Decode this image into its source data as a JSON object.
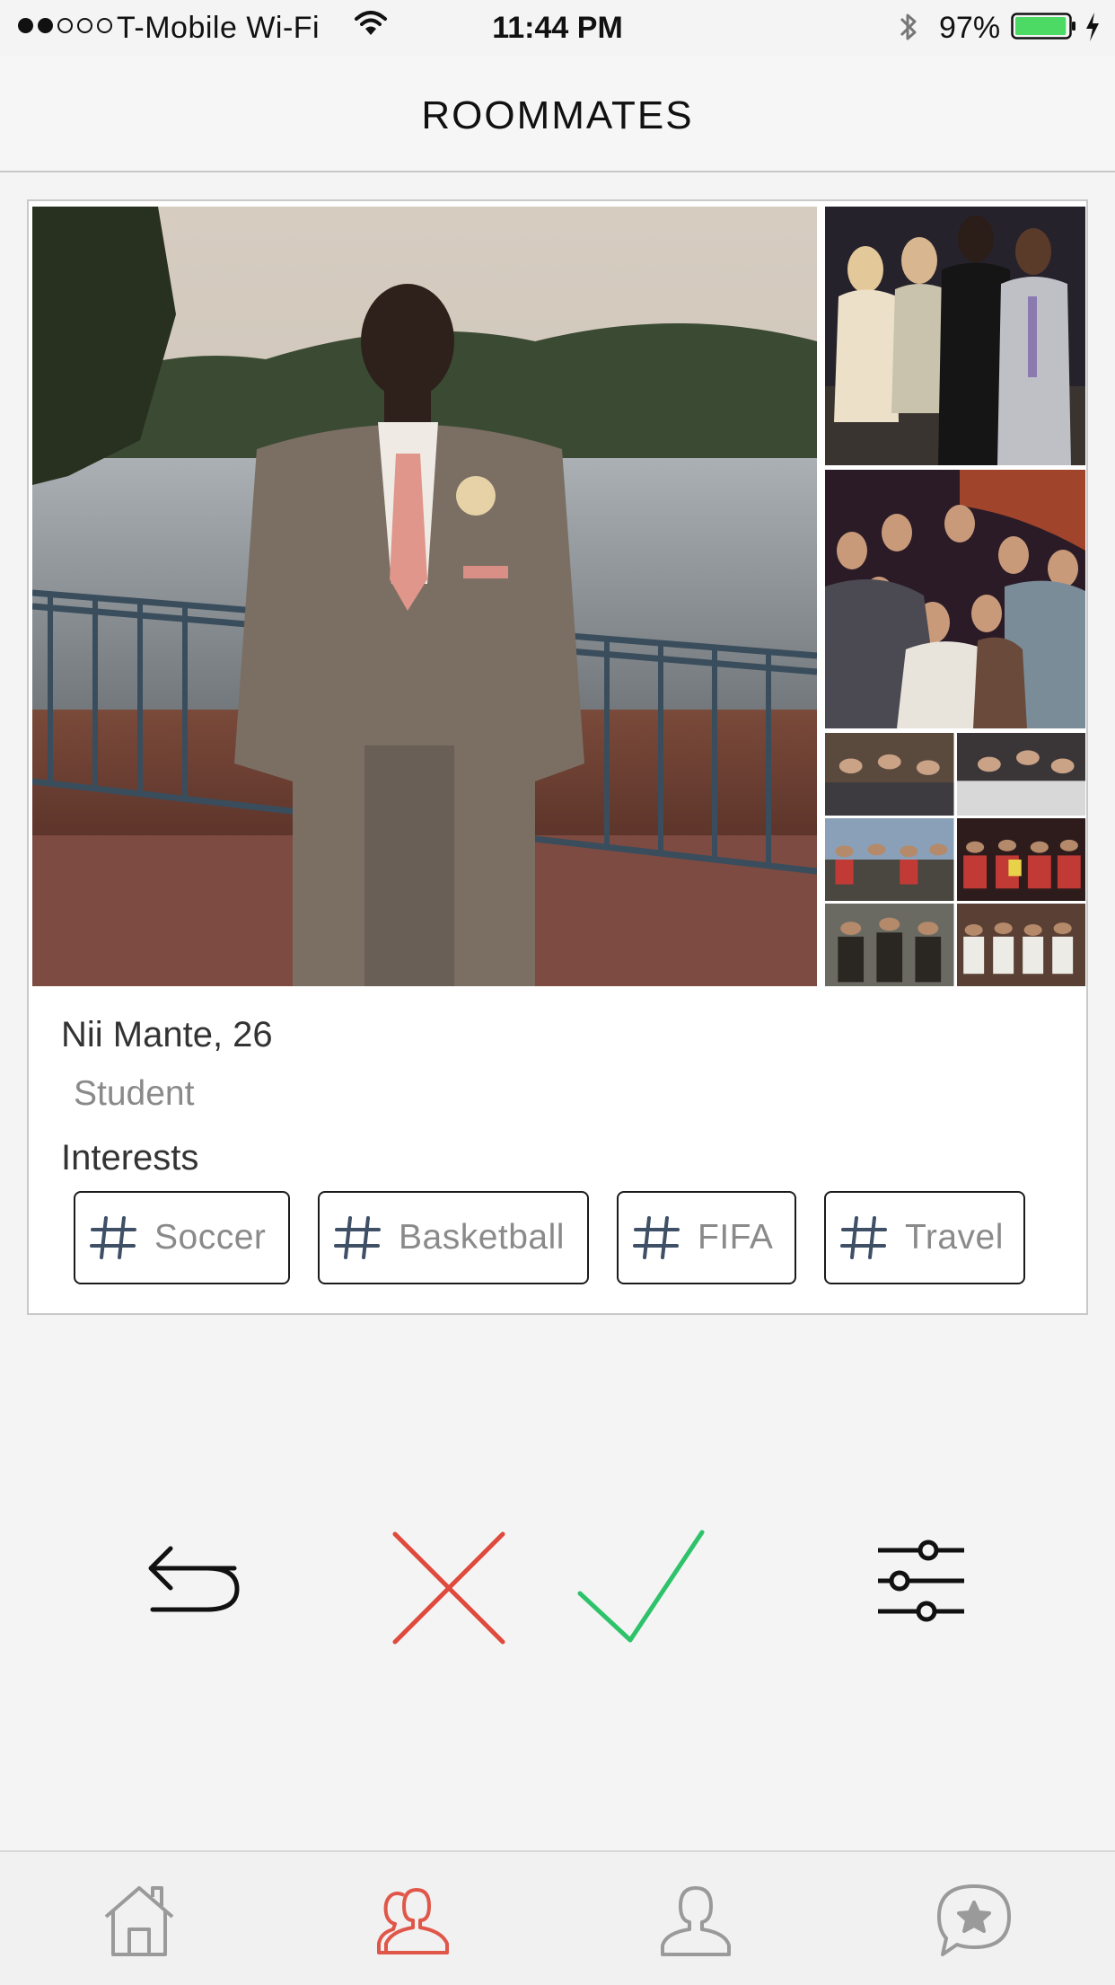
{
  "status_bar": {
    "carrier": "T-Mobile Wi-Fi",
    "time": "11:44 PM",
    "battery": "97%",
    "battery_level": 0.97,
    "signal_bars": 2,
    "icons": [
      "wifi-icon",
      "bluetooth-icon",
      "battery-icon",
      "charging-bolt-icon"
    ]
  },
  "nav": {
    "title": "ROOMMATES"
  },
  "profile": {
    "name_age": "Nii Mante, 26",
    "occupation": "Student",
    "interests_label": "Interests",
    "interests": [
      "Soccer",
      "Basketball",
      "FIFA",
      "Travel"
    ],
    "photos": [
      "main-portrait-photo",
      "group-photo-1",
      "group-photo-2",
      "photo-collage"
    ]
  },
  "actions": {
    "icons": [
      "undo-arrow-icon",
      "reject-x-icon",
      "accept-check-icon",
      "filter-sliders-icon"
    ],
    "colors": {
      "reject": "#e04a3c",
      "accept": "#2ec36a"
    }
  },
  "tab_bar": {
    "tabs": [
      "home-icon",
      "roommates-icon",
      "profile-icon",
      "chat-star-icon"
    ],
    "active": "roommates-icon",
    "colors": {
      "active": "#e0574a",
      "inactive": "#9a9a9a"
    }
  }
}
